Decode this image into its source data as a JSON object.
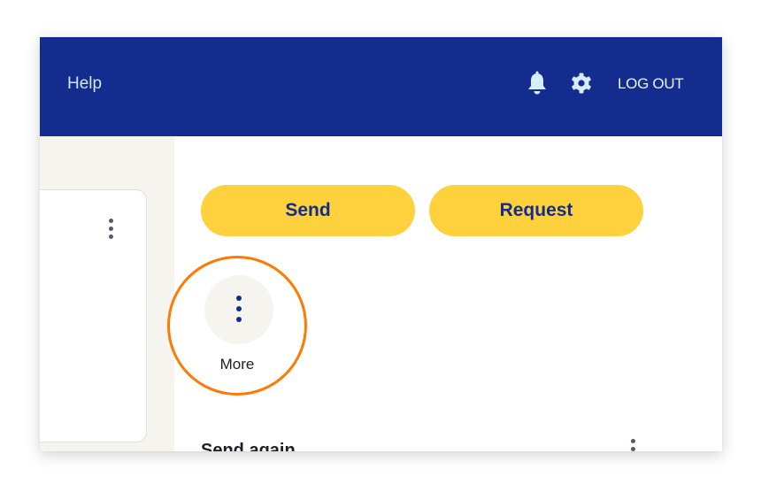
{
  "header": {
    "help_label": "Help",
    "logout_label": "LOG OUT",
    "bell_icon": "bell-icon",
    "settings_icon": "gear-icon"
  },
  "actions": {
    "send_label": "Send",
    "request_label": "Request",
    "more_label": "More"
  },
  "section": {
    "send_again_title": "Send again"
  },
  "colors": {
    "header_bg": "#142c8e",
    "button_bg": "#ffd13c",
    "button_text": "#142c8e",
    "highlight_ring": "#ff7a00",
    "pane_bg": "#f5f4ef"
  }
}
